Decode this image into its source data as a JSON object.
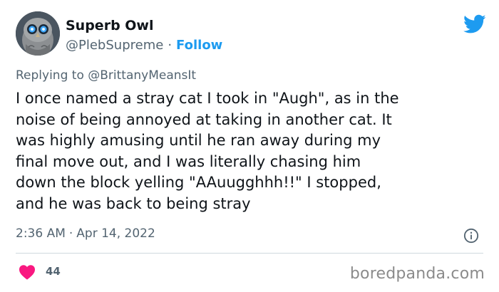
{
  "author": {
    "display_name": "Superb Owl",
    "handle": "@PlebSupreme",
    "separator": "·",
    "follow_label": "Follow"
  },
  "reply": {
    "prefix": "Replying to",
    "mention": "@BrittanyMeansIt"
  },
  "tweet": {
    "lines": [
      "I once named a stray cat I took in \"Augh\", as in the",
      "noise of being annoyed at taking in another cat.  It",
      "was highly amusing until he ran away during my",
      "final move out, and I was literally chasing him",
      "down the block yelling \"AAuugghhh!!\"  I stopped,",
      "and he was back to being stray"
    ]
  },
  "meta": {
    "time": "2:36 AM",
    "separator": "·",
    "date": "Apr 14, 2022"
  },
  "engagement": {
    "likes": "44"
  },
  "watermark": "boredpanda.com",
  "colors": {
    "accent": "#1d9bf0",
    "heart": "#f91880",
    "secondary_text": "#536471",
    "primary_text": "#0f1419"
  },
  "icons": {
    "logo": "twitter-bird-icon",
    "info": "info-icon",
    "like": "heart-icon",
    "avatar": "owl-avatar"
  }
}
